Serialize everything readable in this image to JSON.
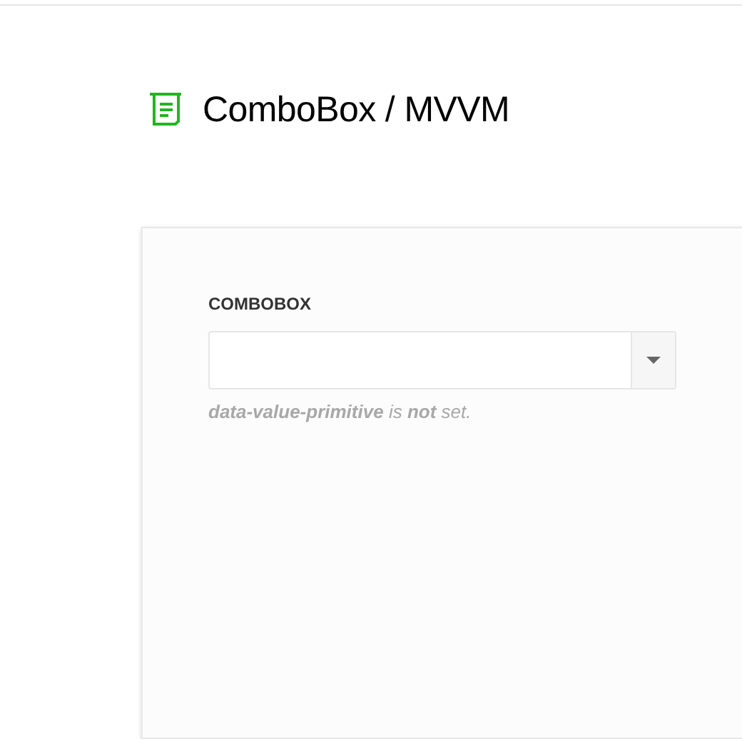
{
  "page": {
    "title": "ComboBox / MVVM"
  },
  "panel": {
    "field_label": "COMBOBOX",
    "note": "**data-value-primitive** is **not** set."
  }
}
